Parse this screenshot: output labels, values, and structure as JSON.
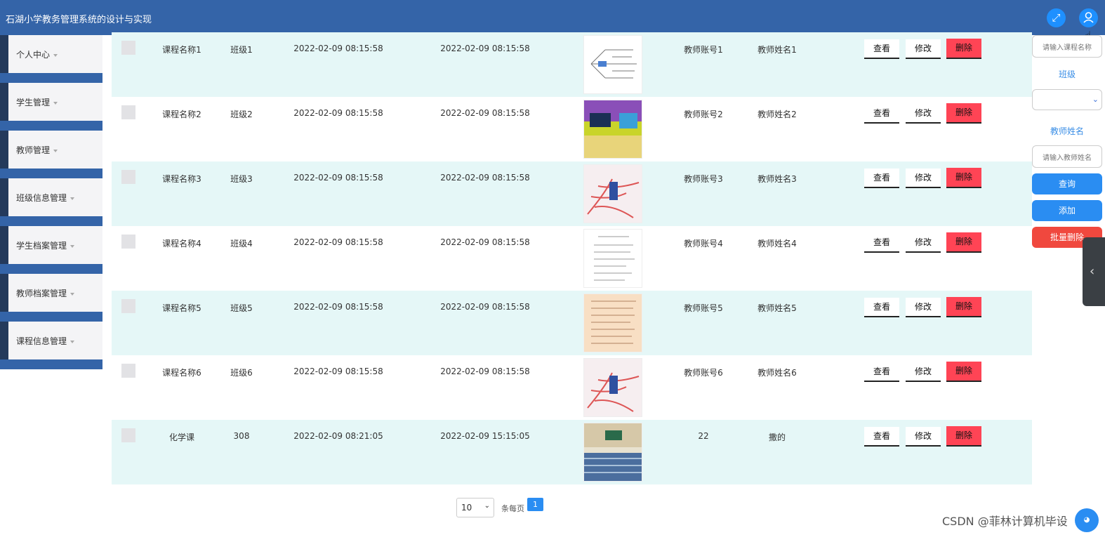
{
  "app": {
    "title": "石湖小学教务管理系统的设计与实现"
  },
  "topbar": {
    "fullscreen_icon": "expand-icon",
    "user_icon": "user-icon"
  },
  "sidebar": {
    "items": [
      {
        "label": "个人中心"
      },
      {
        "label": "学生管理"
      },
      {
        "label": "教师管理"
      },
      {
        "label": "班级信息管理"
      },
      {
        "label": "学生档案管理"
      },
      {
        "label": "教师档案管理"
      },
      {
        "label": "课程信息管理"
      }
    ]
  },
  "table": {
    "actions": {
      "view": "查看",
      "edit": "修改",
      "delete": "删除"
    },
    "rows": [
      {
        "course": "课程名称1",
        "class": "班级1",
        "start": "2022-02-09 08:15:58",
        "end": "2022-02-09 08:15:58",
        "teacher_account": "教师账号1",
        "teacher_name": "教师姓名1",
        "image": "mindmap"
      },
      {
        "course": "课程名称2",
        "class": "班级2",
        "start": "2022-02-09 08:15:58",
        "end": "2022-02-09 08:15:58",
        "teacher_account": "教师账号2",
        "teacher_name": "教师姓名2",
        "image": "classroom-colorful"
      },
      {
        "course": "课程名称3",
        "class": "班级3",
        "start": "2022-02-09 08:15:58",
        "end": "2022-02-09 08:15:58",
        "teacher_account": "教师账号3",
        "teacher_name": "教师姓名3",
        "image": "mindmap-red"
      },
      {
        "course": "课程名称4",
        "class": "班级4",
        "start": "2022-02-09 08:15:58",
        "end": "2022-02-09 08:15:58",
        "teacher_account": "教师账号4",
        "teacher_name": "教师姓名4",
        "image": "document"
      },
      {
        "course": "课程名称5",
        "class": "班级5",
        "start": "2022-02-09 08:15:58",
        "end": "2022-02-09 08:15:58",
        "teacher_account": "教师账号5",
        "teacher_name": "教师姓名5",
        "image": "document-orange"
      },
      {
        "course": "课程名称6",
        "class": "班级6",
        "start": "2022-02-09 08:15:58",
        "end": "2022-02-09 08:15:58",
        "teacher_account": "教师账号6",
        "teacher_name": "教师姓名6",
        "image": "mindmap-red"
      },
      {
        "course": "化学课",
        "class": "308",
        "start": "2022-02-09 08:21:05",
        "end": "2022-02-09 15:15:05",
        "teacher_account": "22",
        "teacher_name": "撒的",
        "image": "classroom-blue"
      }
    ]
  },
  "search": {
    "course_placeholder": "请输入课程名称",
    "class_label": "班级",
    "class_value": "",
    "teacher_label": "教师姓名",
    "teacher_placeholder": "请输入教师姓名",
    "query_button": "查询",
    "add_button": "添加",
    "batch_delete_button": "批量删除"
  },
  "pagination": {
    "page_size": "10",
    "per_page_label": "条每页",
    "current_page": "1"
  },
  "watermark": "CSDN @菲林计算机毕设",
  "colors": {
    "header": "#3464a8",
    "row_alt": "#e5f7f7",
    "primary": "#2a8df2",
    "danger": "#ff4455"
  }
}
